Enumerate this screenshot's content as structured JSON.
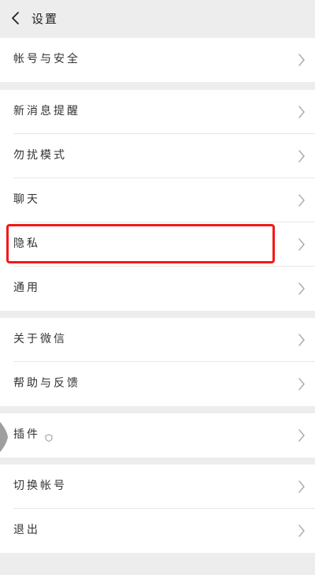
{
  "header": {
    "title": "设置",
    "back_icon": "back-chevron-icon"
  },
  "sections": [
    {
      "items": [
        {
          "label": "帐号与安全",
          "icon": "chevron-right-icon"
        }
      ]
    },
    {
      "items": [
        {
          "label": "新消息提醒",
          "icon": "chevron-right-icon"
        },
        {
          "label": "勿扰模式",
          "icon": "chevron-right-icon"
        },
        {
          "label": "聊天",
          "icon": "chevron-right-icon"
        },
        {
          "label": "隐私",
          "icon": "chevron-right-icon",
          "highlighted": true
        },
        {
          "label": "通用",
          "icon": "chevron-right-icon"
        }
      ]
    },
    {
      "items": [
        {
          "label": "关于微信",
          "icon": "chevron-right-icon"
        },
        {
          "label": "帮助与反馈",
          "icon": "chevron-right-icon"
        }
      ]
    },
    {
      "items": [
        {
          "label": "插件",
          "icon": "chevron-right-icon",
          "badge_icon": "plugin-shield-icon"
        }
      ]
    },
    {
      "items": [
        {
          "label": "切换帐号",
          "icon": "chevron-right-icon"
        },
        {
          "label": "退出",
          "icon": "chevron-right-icon"
        }
      ]
    }
  ],
  "colors": {
    "background": "#ededed",
    "row_background": "#ffffff",
    "highlight_border": "#f31818",
    "text": "#333333",
    "chevron": "#a9a9a9"
  }
}
